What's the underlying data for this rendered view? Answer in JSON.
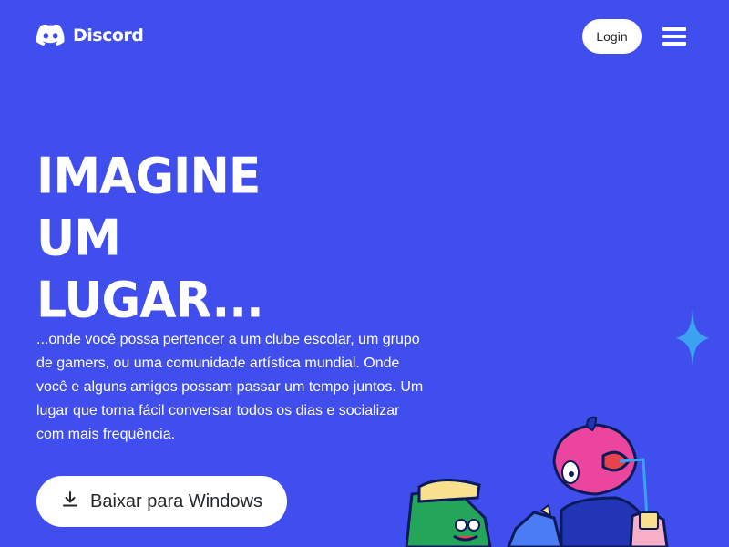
{
  "header": {
    "brand_name": "Discord",
    "login_label": "Login"
  },
  "hero": {
    "title_lines": [
      "IMAGINE",
      "UM",
      "LUGAR..."
    ],
    "description": "...onde você possa pertencer a um clube escolar, um grupo de gamers, ou uma comunidade artística mundial. Onde você e alguns amigos possam passar um tempo juntos. Um lugar que torna fácil conversar todos os dias e socializar com mais frequência.",
    "download_label": "Baixar para Windows"
  },
  "icons": {
    "logo": "discord-logo-icon",
    "menu": "hamburger-menu-icon",
    "download": "download-icon",
    "sparkle": "sparkle-icon"
  },
  "colors": {
    "background": "#404EED",
    "button_bg": "#FFFFFF",
    "button_text": "#23272A",
    "sparkle": "#3BA1F1"
  }
}
